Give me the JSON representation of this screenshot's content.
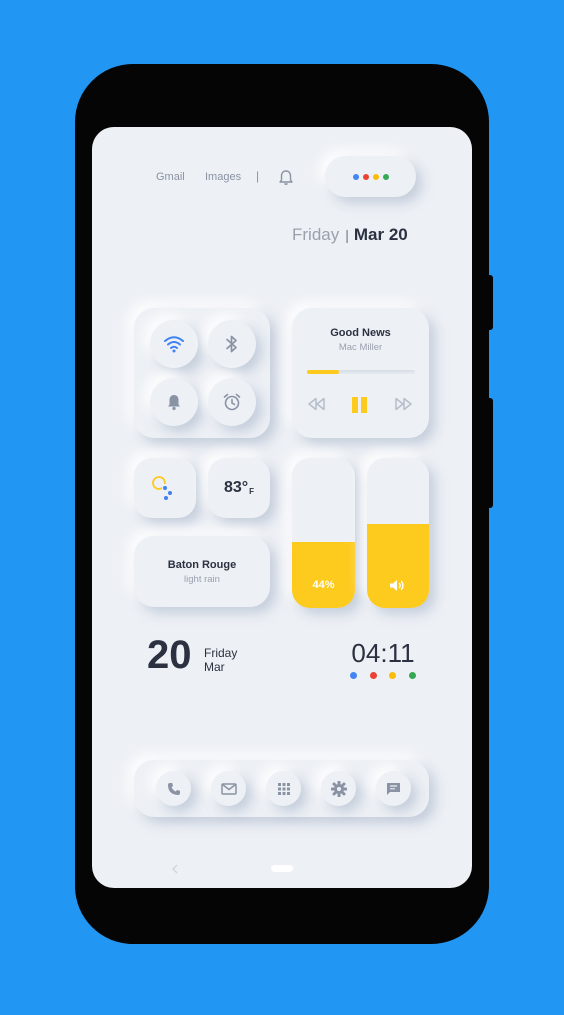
{
  "header": {
    "links": [
      "Gmail",
      "Images"
    ],
    "separator": "|",
    "google_dots": [
      "#4285F4",
      "#EA4335",
      "#FBBC05",
      "#34A853"
    ]
  },
  "date_top": {
    "day": "Friday",
    "separator": "|",
    "date": "Mar 20"
  },
  "quick_toggles": [
    {
      "icon": "wifi-icon",
      "active": true
    },
    {
      "icon": "bluetooth-icon",
      "active": false
    },
    {
      "icon": "bell-icon",
      "active": false
    },
    {
      "icon": "alarm-clock-icon",
      "active": false
    }
  ],
  "music": {
    "title": "Good News",
    "artist": "Mac Miller",
    "progress": 0.3,
    "controls": [
      "rewind-icon",
      "pause-icon",
      "fast-forward-icon"
    ]
  },
  "weather": {
    "icon": "partly-rainy-icon",
    "temperature": "83°",
    "unit": "F",
    "city": "Baton Rouge",
    "condition": "light rain"
  },
  "sliders": {
    "brightness": {
      "label": "44%",
      "level": 0.44
    },
    "volume": {
      "level": 0.56,
      "icon": "speaker-icon"
    }
  },
  "date_widget": {
    "day_number": "20",
    "weekday": "Friday",
    "month": "Mar"
  },
  "clock": {
    "time": "04:11",
    "dots": [
      "#4285F4",
      "#EA4335",
      "#FBBC05",
      "#34A853"
    ]
  },
  "dock": [
    "phone-icon",
    "mail-icon",
    "apps-grid-icon",
    "settings-gear-icon",
    "messages-icon"
  ],
  "colors": {
    "background": "#2196F3",
    "screen": "#EDF0F5",
    "accent": "#FDCA1E",
    "text_dark": "#2B3140",
    "text_muted": "#8A93A3"
  }
}
